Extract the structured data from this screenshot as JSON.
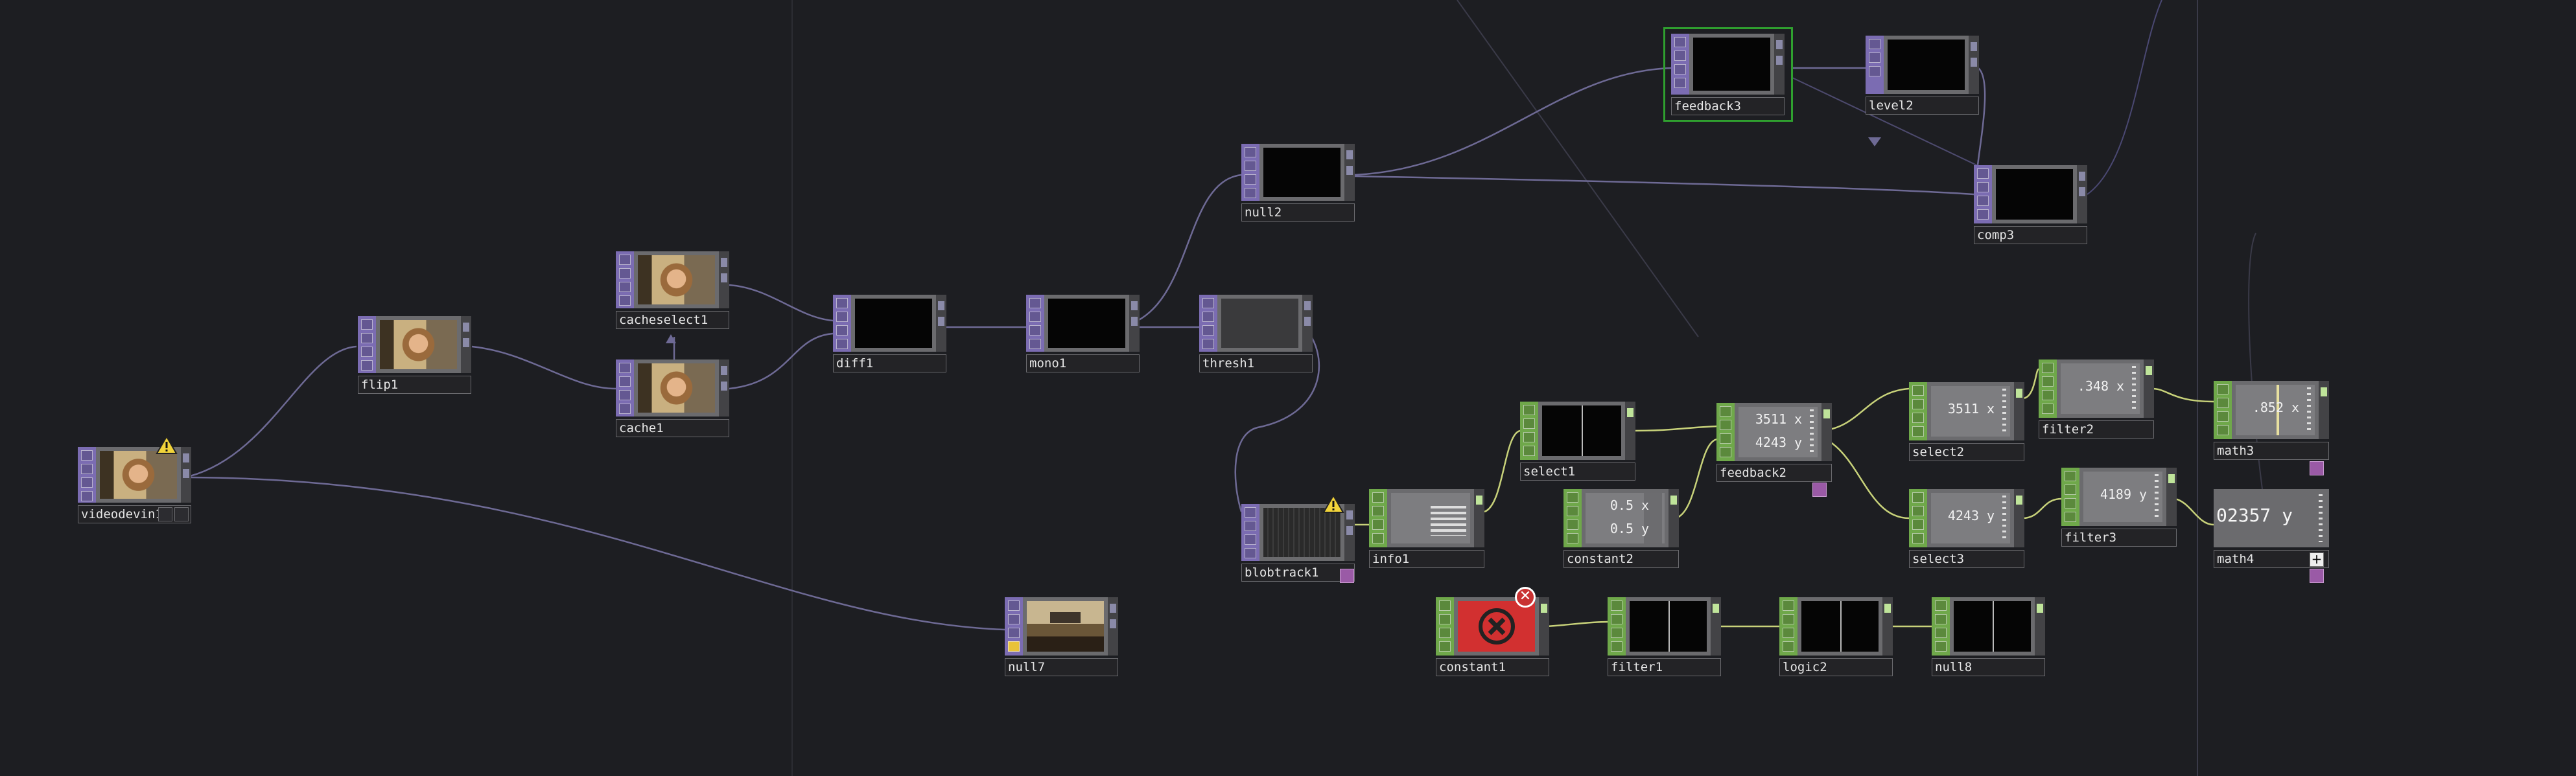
{
  "app": {
    "title": "TouchDesigner Network Editor"
  },
  "nodes": {
    "videodevin1": "videodevin1",
    "flip1": "flip1",
    "cacheselect1": "cacheselect1",
    "cache1": "cache1",
    "diff1": "diff1",
    "mono1": "mono1",
    "thresh1": "thresh1",
    "null2": "null2",
    "feedback3": "feedback3",
    "level2": "level2",
    "comp3": "comp3",
    "blobtrack1": "blobtrack1",
    "info1": "info1",
    "null7": "null7",
    "select1": "select1",
    "constant2": "constant2",
    "feedback2": "feedback2",
    "select2": "select2",
    "select3": "select3",
    "filter2": "filter2",
    "filter3": "filter3",
    "math3": "math3",
    "math4": "math4",
    "constant1": "constant1",
    "filter1": "filter1",
    "logic2": "logic2",
    "null8": "null8"
  },
  "values": {
    "feedback2_x": "3511",
    "feedback2_y": "4243",
    "select2_x": "3511",
    "select3_y": "4243",
    "constant2_x": "0.5",
    "constant2_y": "0.5",
    "filter2_x": ".348",
    "filter3_y": "4189",
    "math3_x": ".852",
    "math4_y": "02357"
  },
  "chan_names": {
    "x": "x",
    "y": "y"
  },
  "icons": {
    "warning": "warning-icon",
    "error": "error-icon",
    "plus": "plus-icon",
    "flag": "flag-icon"
  },
  "colors": {
    "background": "#1d1e22",
    "top_operator": "#7b6cb2",
    "chop_operator": "#6fa84a",
    "wire": "#6e6a95",
    "selection": "#2fa02f",
    "error": "#c93232"
  }
}
